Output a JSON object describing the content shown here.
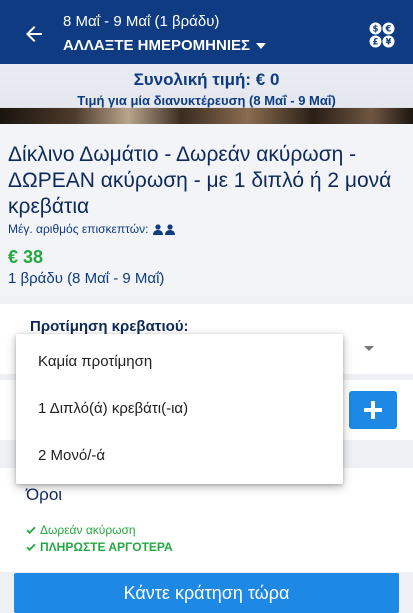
{
  "header": {
    "dates": "8 Μαΐ - 9 Μαΐ (1 βράδυ)",
    "change_dates": "ΑΛΛΑΞΤΕ ΗΜΕΡΟΜΗΝΙΕΣ",
    "background_color": "#0e3b82"
  },
  "banner": {
    "total_price": "Συνολική τιμή: € 0",
    "per_night": "Τιμή για μία διανυκτέρευση (8 Μαΐ - 9 Μαΐ)"
  },
  "room": {
    "title": "Δίκλινο Δωμάτιο - Δωρεάν ακύρωση - ΔΩΡΕΑΝ ακύρωση - με 1 διπλό ή 2 μονά κρεβάτια",
    "max_guests_label": "Μέγ. αριθμός επισκεπτών:",
    "price": "€ 38",
    "nights": "1 βράδυ (8 Μαΐ - 9 Μαΐ)"
  },
  "bed_preference": {
    "label": "Προτίμηση κρεβατιού:",
    "options": [
      "Καμία προτίμηση",
      "1 Διπλό(ά) κρεβάτι(-ια)",
      "2 Μονό/-ά"
    ]
  },
  "terms": {
    "title": "Όροι",
    "items": [
      "Δωρεάν ακύρωση",
      "ΠΛΗΡΩΣΤΕ ΑΡΓΟΤΕΡΑ"
    ],
    "accent_color": "#25a742"
  },
  "book_button": "Κάντε κράτηση τώρα",
  "accent_color": "#1e88e5"
}
